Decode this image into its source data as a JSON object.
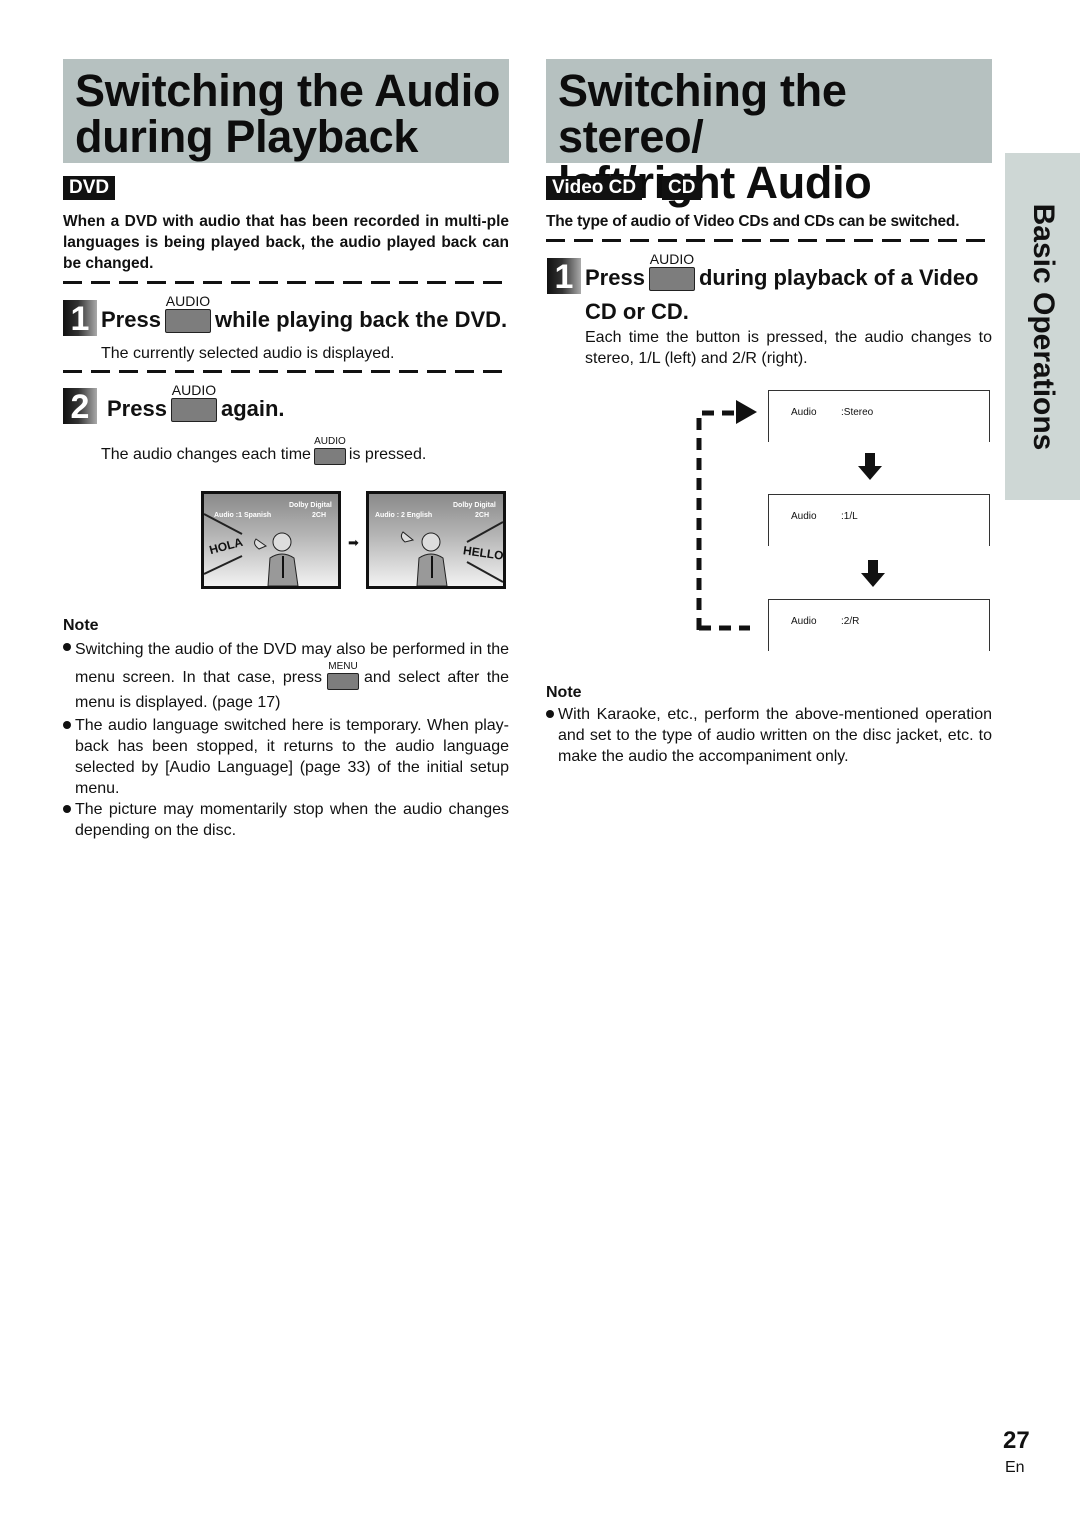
{
  "left": {
    "title_line1": "Switching the Audio",
    "title_line2": "during Playback",
    "badge": "DVD",
    "lead": "When a DVD with audio that has been recorded in multi-ple languages is being played back, the audio played back can be changed.",
    "step1": {
      "number": "1",
      "press": "Press",
      "button_label": "AUDIO",
      "rest": "while playing back the DVD.",
      "desc": "The currently selected audio is displayed."
    },
    "step2": {
      "number": "2",
      "press": "Press",
      "button_label": "AUDIO",
      "rest": "again.",
      "desc_before": "The audio changes each time",
      "desc_button_label": "AUDIO",
      "desc_after": "is pressed."
    },
    "illustration": {
      "screen1": {
        "osd_audio": "Audio  :1 Spanish",
        "osd_format_line1": "Dolby Digital",
        "osd_format_line2": "2CH",
        "speech": "HOLA"
      },
      "arrow": "➡",
      "screen2": {
        "osd_audio": "Audio  : 2 English",
        "osd_format_line1": "Dolby Digital",
        "osd_format_line2": "2CH",
        "speech": "HELLO"
      }
    },
    "note": {
      "title": "Note",
      "bullet1_before": "Switching the audio of the DVD may also be performed in the menu screen. In that case, press",
      "bullet1_button_label": "MENU",
      "bullet1_after": "and select after the menu is displayed. (page 17)",
      "bullet2": "The audio language switched here is temporary. When play-back has been stopped, it returns to the audio language selected by [Audio Language] (page 33) of the initial setup menu.",
      "bullet3": "The picture may momentarily stop when the audio changes depending on the disc."
    }
  },
  "right": {
    "title_line1": "Switching the stereo/",
    "title_line2": "left/right Audio",
    "badges": [
      "Video CD",
      "CD"
    ],
    "lead": "The type of audio of Video CDs and CDs can be switched.",
    "step1": {
      "number": "1",
      "press": "Press",
      "button_label": "AUDIO",
      "rest": "during playback of a Video",
      "rest_line2": "CD or CD.",
      "desc": "Each time the button is pressed, the audio changes to stereo, 1/L (left) and 2/R (right)."
    },
    "cycle_diagram": [
      {
        "key": "Audio",
        "value": ":Stereo"
      },
      {
        "key": "Audio",
        "value": ":1/L"
      },
      {
        "key": "Audio",
        "value": ":2/R"
      }
    ],
    "note": {
      "title": "Note",
      "bullet1": "With Karaoke, etc., perform the above-mentioned operation and set to the type of audio written on the disc jacket, etc. to make the audio the accompaniment only."
    }
  },
  "side_tab": "Basic Operations",
  "footer": {
    "page_number": "27",
    "language": "En"
  }
}
